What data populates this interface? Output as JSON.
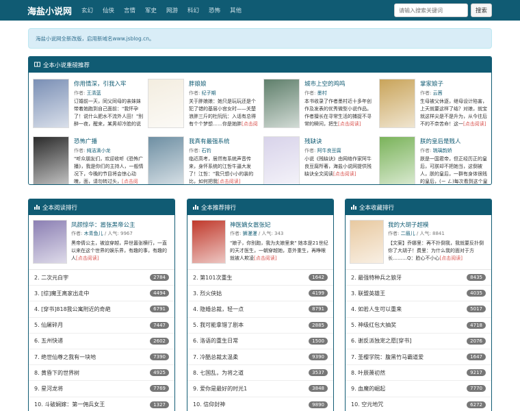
{
  "navbar": {
    "brand": "海盐小说网",
    "items": [
      "玄幻",
      "仙侠",
      "言情",
      "军史",
      "网游",
      "科幻",
      "恐怖",
      "其他"
    ],
    "search_placeholder": "请输入搜索关键词",
    "search_button": "搜索"
  },
  "notice": "海盐小说网全新改版，启用新域名www.jsblog.cn。",
  "recommend": {
    "title": "全本小说重磅推荐",
    "read_label": "[点击阅读]",
    "items": [
      {
        "title": "你用情深，引我入牢",
        "author_label": "作者:",
        "author": "王清蓝",
        "desc": "订婚前一天，同父同母的亲妹妹带着她跑到自己面前：\"我怀孕了！说什么肥水不流外人田！\"别醉一夜，醒来，某男却冷脸的说道",
        "cover_color": "#7a8fb5",
        "cover_text": "你用情深"
      },
      {
        "title": "胖娘娘",
        "author_label": "作者:",
        "author": "纪子期",
        "desc": "关于胖娘娘：她只是玩玩还是个犯了错的基层小宫女时——关楚浪胖三斤的杜阮阮：入话有总得有个个梦想……你是她胖",
        "cover_color": "#f3ede0",
        "cover_text": "胖"
      },
      {
        "title": "城市上空的鸡鸣",
        "author_label": "作者:",
        "author": "墨村",
        "desc": "本书收录了作者墨村近十多年创作及发表的优秀微型小说作品。作者擅长在寻常生活的捕捉不寻常的瞬间，把生",
        "cover_color": "#5f7f6b",
        "cover_text": "城市上空"
      },
      {
        "title": "掌家娘子",
        "author_label": "作者:",
        "author": "云茜",
        "desc": "生母被父休逐，继母设计陷害，上天就要这样了结？对娘，就宝就这样尖是不是升为，从今往后不的不奈苦命！这一",
        "cover_color": "#c9a45a",
        "cover_text": "掌家娘子"
      },
      {
        "title": "恐怖广播",
        "author_label": "作者:",
        "author": "纯洁滴小龙",
        "desc": "\"听众朋友们，欢迎收听《恐怖广播》，我是你们的主持人，一般情况下，今晚的节目将会惊心动魄，面，请勿转过头，",
        "cover_color": "#2b2b2b",
        "cover_text": "恐怖广播"
      },
      {
        "title": "我真有最强系统",
        "author_label": "作者:",
        "author": "石钓",
        "desc": "临近高考，居然有系统声音传来，身怀系统的江哲牛逼大发了！江哲：\"我只想小小的装的比，如何把我",
        "cover_color": "#6e8fa3",
        "cover_text": "最强系统"
      },
      {
        "title": "残缺诀",
        "author_label": "作者:",
        "author": "阿牛良豆腐",
        "desc": "小说《残缺诀》由网络作家阿牛良豆腐所著，海盐小说网提供残缺诀全文阅读",
        "cover_color": "#d8d3ea",
        "cover_text": "残缺诀"
      },
      {
        "title": "朕的皇后是贱人",
        "author_label": "作者:",
        "author": "琉璃韵娇",
        "desc": "朕是一国君帝，但正经历正的皇后，可朕却不把她当，这倒被人，朕的皇后，一群有身体很贱的皇后，(ㄧ ㄥ)每次看到这个皇后，",
        "cover_color": "#7ab35a",
        "cover_text": "朕的皇后"
      }
    ]
  },
  "ranks": [
    {
      "title": "全本阅读排行",
      "top": {
        "title": "凤颜惊华：嚣张黑帝公主",
        "author_label": "作者:",
        "author": "木青鱼儿",
        "pop_label": "/ 人气:",
        "pop": "9967",
        "desc": "黑帝倩公主，被迫穿越，异世嚣张横行，一直以来在这个世界的娱乐界，有趣的事，有趣的人",
        "cover_color": "#8b7fb3"
      },
      "read_label": "[点击阅读]",
      "list": [
        {
          "name": "2. 二次元白宇",
          "count": "2784"
        },
        {
          "name": "3. [综]魔王离家出走中",
          "count": "4494"
        },
        {
          "name": "4. [穿书]818我公寓附近的奇葩",
          "count": "6791"
        },
        {
          "name": "5. 仙屠碎月",
          "count": "7447"
        },
        {
          "name": "6. 五州快递",
          "count": "2602"
        },
        {
          "name": "7. 绝世仙尊之我有一块地",
          "count": "7390"
        },
        {
          "name": "8. 黄昏下的世界树",
          "count": "4925"
        },
        {
          "name": "9. 星河龙将",
          "count": "7769"
        },
        {
          "name": "10. 斗破娴嫁：第一佣兵女王",
          "count": "1327"
        }
      ]
    },
    {
      "title": "全本推荐排行",
      "top": {
        "title": "神医嫡女嚣张妃",
        "author_label": "作者:",
        "author": "狮漫漫",
        "pop_label": "/ 人气:",
        "pop": "343",
        "desc": "\"娘子，你别跑，我为夫娘里来\" 她本是21世纪的天才医生，一朝穿越她，意外重生，再睁眼就被人欺凌",
        "cover_color": "#c0392b"
      },
      "read_label": "[点击阅读]",
      "list": [
        {
          "name": "2. 第101次重生",
          "count": "1642"
        },
        {
          "name": "3. 烈火侠姑",
          "count": "4199"
        },
        {
          "name": "4. 隐婚总裁，轻一点",
          "count": "8791"
        },
        {
          "name": "5. 我可能拿错了剧本",
          "count": "2885"
        },
        {
          "name": "6. 洛语的重生日常",
          "count": "1500"
        },
        {
          "name": "7. 冷酷总裁太温柔",
          "count": "9390"
        },
        {
          "name": "8. 七国乱，为将之道",
          "count": "3537"
        },
        {
          "name": "9. 爱你是最好的时光1",
          "count": "3848"
        },
        {
          "name": "10. 信仰封神",
          "count": "9890"
        }
      ]
    },
    {
      "title": "全本收藏排行",
      "top": {
        "title": "我的大胡子超模",
        "author_label": "作者:",
        "author": "二眉儿",
        "pop_label": "/ 人气:",
        "pop": "8841",
        "desc": "【文案】乔娜里：再不扑倒我，我就要反扑倒你了大胡子！费里：为什么我的面对于方长………Q：脸心不小心",
        "cover_color": "#e8c9a0"
      },
      "read_label": "[点击阅读]",
      "list": [
        {
          "name": "2. 最强特种兵之狼牙",
          "count": "8435"
        },
        {
          "name": "3. 联盟英雄王",
          "count": "4035"
        },
        {
          "name": "4. 如若人生可以重来",
          "count": "5017"
        },
        {
          "name": "5. 神级红包大抽奖",
          "count": "4718"
        },
        {
          "name": "6. 谢反派独宠之愿[穿书]",
          "count": "2076"
        },
        {
          "name": "7. 圣樱学院：腹黑竹马霸道爱",
          "count": "1647"
        },
        {
          "name": "8. 叶辰萧初然",
          "count": "9217"
        },
        {
          "name": "9. 血魔的崛起",
          "count": "7770"
        },
        {
          "name": "10. 空元地咒",
          "count": "6272"
        }
      ]
    }
  ]
}
